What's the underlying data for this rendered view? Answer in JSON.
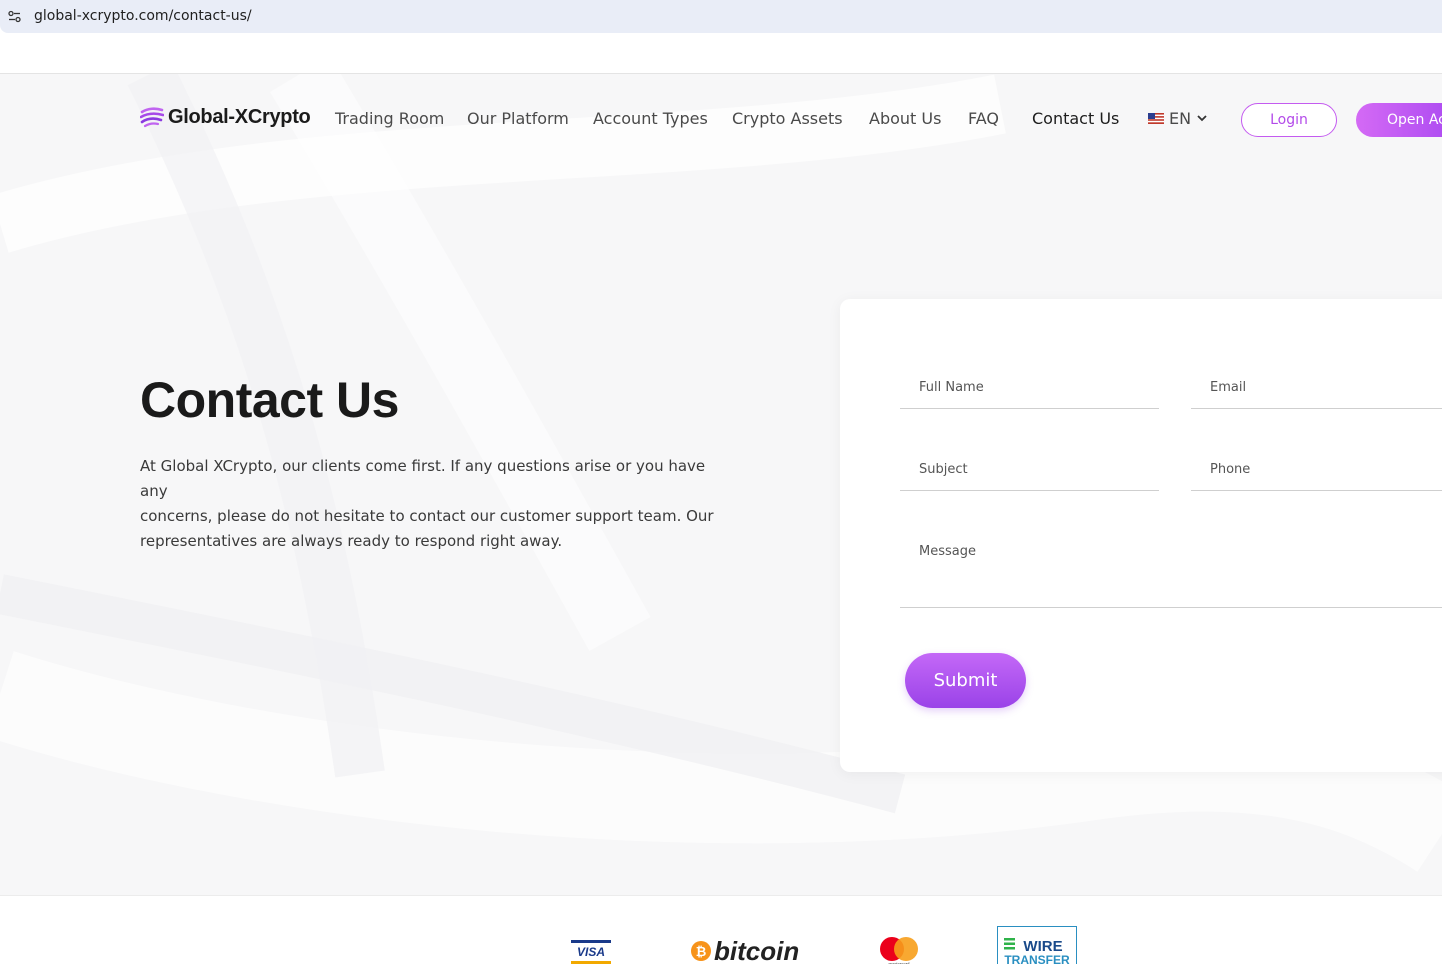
{
  "browser": {
    "url": "global-xcrypto.com/contact-us/"
  },
  "nav": {
    "logo_text": "Global-XCrypto",
    "items": [
      "Trading Room",
      "Our Platform",
      "Account Types",
      "Crypto Assets",
      "About Us",
      "FAQ",
      "Contact Us"
    ],
    "active_item": "Contact Us",
    "language": "EN",
    "login_label": "Login",
    "open_account_label": "Open Ac"
  },
  "hero": {
    "title": "Contact Us",
    "intro_lines": [
      "At Global XCrypto, our clients come first. If any questions arise or you have any",
      "concerns, please do not hesitate to contact our customer support team. Our",
      "representatives are always ready to respond right away."
    ]
  },
  "form": {
    "full_name_placeholder": "Full Name",
    "email_placeholder": "Email",
    "subject_placeholder": "Subject",
    "phone_placeholder": "Phone",
    "message_placeholder": "Message",
    "submit_label": "Submit"
  },
  "footer": {
    "payment_methods": [
      "VISA",
      "bitcoin",
      "mastercard",
      "WIRE TRANSFER"
    ]
  },
  "colors": {
    "accent": "#b34ae9",
    "accent_gradient_start": "#d46af5",
    "accent_gradient_end": "#9b3df0"
  }
}
